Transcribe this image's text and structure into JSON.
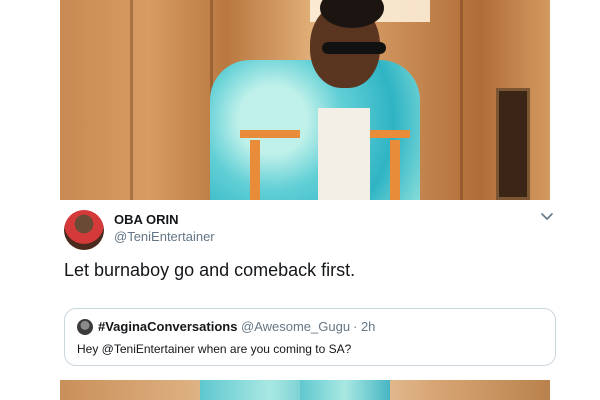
{
  "tweet": {
    "user": {
      "name": "OBA ORIN",
      "handle": "@TeniEntertainer"
    },
    "text": "Let burnaboy go and comeback first.",
    "menu_icon": "chevron-down-icon",
    "quoted": {
      "name": "#VaginaConversations",
      "handle": "@Awesome_Gugu",
      "time": "· 2h",
      "text": "Hey @TeniEntertainer when are you coming to SA?"
    }
  },
  "colors": {
    "text_primary": "#14171a",
    "text_secondary": "#657786",
    "border": "#ccd6dd"
  }
}
